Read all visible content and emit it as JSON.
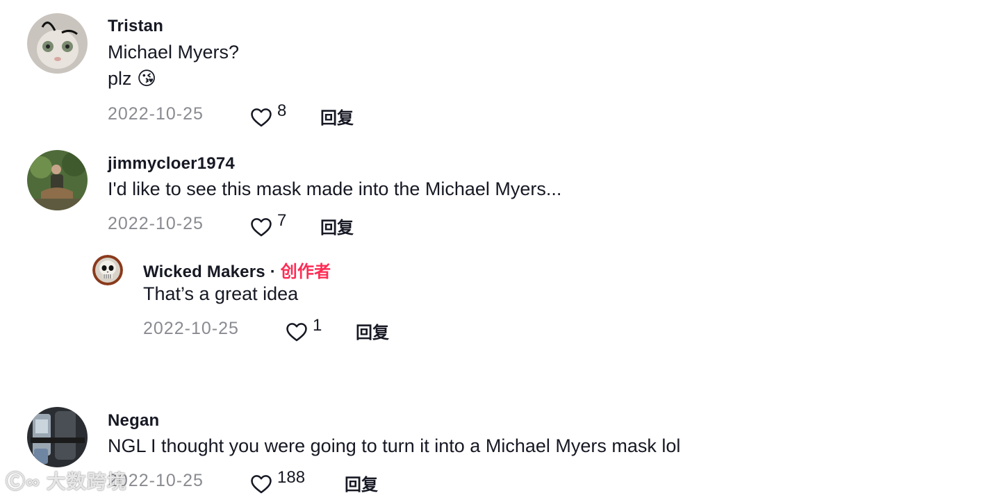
{
  "comments": [
    {
      "username": "Tristan",
      "lines": [
        "Michael Myers?",
        "plz 😘"
      ],
      "date": "2022-10-25",
      "likes": "8",
      "reply_label": "回复"
    },
    {
      "username": "jimmycloer1974",
      "lines": [
        "I'd like to see this mask made into the Michael Myers..."
      ],
      "date": "2022-10-25",
      "likes": "7",
      "reply_label": "回复",
      "replies": [
        {
          "username": "Wicked Makers",
          "separator": "·",
          "creator_badge": "创作者",
          "lines": [
            "That’s a great idea"
          ],
          "date": "2022-10-25",
          "likes": "1",
          "reply_label": "回复"
        }
      ]
    },
    {
      "username": "Negan",
      "lines": [
        "NGL I thought you were going to turn it into a Michael Myers mask lol"
      ],
      "date": "2022-10-25",
      "likes": "188",
      "reply_label": "回复"
    }
  ],
  "watermark": "大数跨境",
  "colors": {
    "creator": "#fe2c55",
    "meta_gray": "#8a8b91",
    "text": "#161823"
  },
  "icons": {
    "like": "heart-outline-icon"
  }
}
